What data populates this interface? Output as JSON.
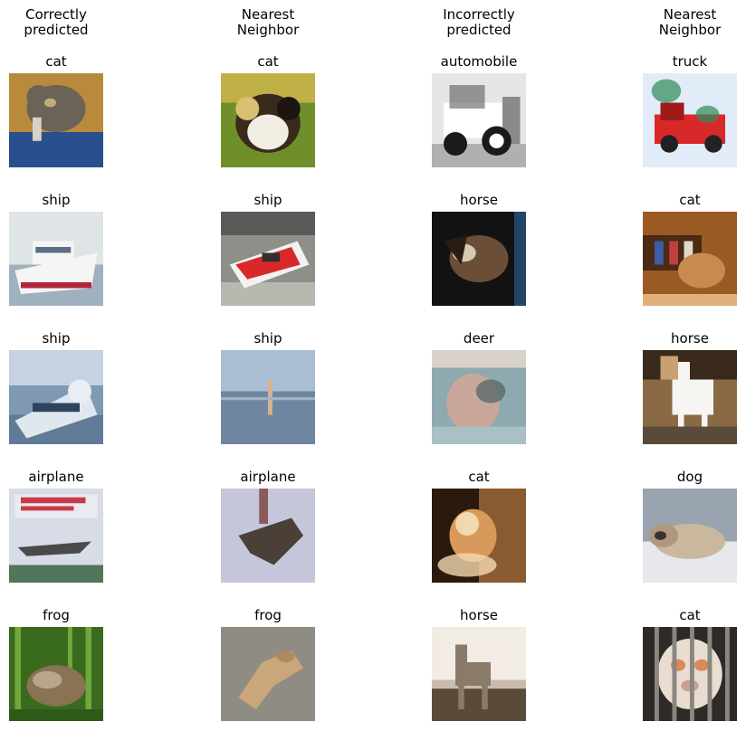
{
  "headers": [
    "Correctly\npredicted",
    "Nearest\nNeighbor",
    "Incorrectly\npredicted",
    "Nearest\nNeighbor"
  ],
  "rows": [
    [
      {
        "label": "cat",
        "scene": "cat-orange",
        "bg": "#b98a3c",
        "mid": "#6b6258",
        "accent": "#2a4f8e",
        "light": "#d9d2c6"
      },
      {
        "label": "cat",
        "scene": "cat-green",
        "bg": "#6f8f2a",
        "mid": "#3a2a1c",
        "accent": "#d8c070",
        "light": "#f2ede2"
      },
      {
        "label": "automobile",
        "scene": "car-bw",
        "bg": "#e6e6e6",
        "mid": "#5c5c5c",
        "accent": "#1a1a1a",
        "light": "#ffffff"
      },
      {
        "label": "truck",
        "scene": "truck-red",
        "bg": "#cfe0f5",
        "mid": "#d9282a",
        "accent": "#2e8a5a",
        "light": "#f5f8fc"
      }
    ],
    [
      {
        "label": "ship",
        "scene": "ship-white",
        "bg": "#dfe5e6",
        "mid": "#f5f5f5",
        "accent": "#b3263a",
        "light": "#5a6f86"
      },
      {
        "label": "ship",
        "scene": "boat-red",
        "bg": "#8f8f8a",
        "mid": "#d9282a",
        "accent": "#f2f2f2",
        "light": "#b8b8b0"
      },
      {
        "label": "horse",
        "scene": "horse-dark",
        "bg": "#121212",
        "mid": "#6b4e38",
        "accent": "#d9c9b2",
        "light": "#2a5d8e"
      },
      {
        "label": "cat",
        "scene": "cat-wood",
        "bg": "#9a5a24",
        "mid": "#c98a50",
        "accent": "#3b5ea8",
        "light": "#e2b07a"
      }
    ],
    [
      {
        "label": "ship",
        "scene": "ship-blue",
        "bg": "#7f99b3",
        "mid": "#e1e7ee",
        "accent": "#2e435c",
        "light": "#c5d3e0"
      },
      {
        "label": "ship",
        "scene": "sea-calm",
        "bg": "#8fa7c2",
        "mid": "#6f86a1",
        "accent": "#d9b48a",
        "light": "#a9bdd3"
      },
      {
        "label": "deer",
        "scene": "deer-blur",
        "bg": "#8ea9b0",
        "mid": "#c9a79a",
        "accent": "#5a6b6b",
        "light": "#d9d2c9"
      },
      {
        "label": "horse",
        "scene": "horse-white",
        "bg": "#8a6a45",
        "mid": "#f5f5f2",
        "accent": "#3a2a1c",
        "light": "#c9a070"
      }
    ],
    [
      {
        "label": "airplane",
        "scene": "plane-poster",
        "bg": "#d8dce6",
        "mid": "#4a4a4a",
        "accent": "#c83a46",
        "light": "#2e5d3a"
      },
      {
        "label": "airplane",
        "scene": "plane-lavender",
        "bg": "#bdbcd4",
        "mid": "#4a4038",
        "accent": "#8c5a5a",
        "light": "#d5d4e4"
      },
      {
        "label": "cat",
        "scene": "cat-shadow",
        "bg": "#2a1a0e",
        "mid": "#d89a5a",
        "accent": "#f2d8b0",
        "light": "#8a5a30"
      },
      {
        "label": "dog",
        "scene": "dog-sleep",
        "bg": "#9aa3b0",
        "mid": "#c9b89e",
        "accent": "#3a3430",
        "light": "#e6e8ec"
      }
    ],
    [
      {
        "label": "frog",
        "scene": "frog-grass",
        "bg": "#3a6a1e",
        "mid": "#8a7254",
        "accent": "#6fa83a",
        "light": "#b8a58a"
      },
      {
        "label": "frog",
        "scene": "frog-gravel",
        "bg": "#7d7a72",
        "mid": "#c9a77a",
        "accent": "#5e5a52",
        "light": "#a19d94"
      },
      {
        "label": "horse",
        "scene": "horse-beach",
        "bg": "#f2ece4",
        "mid": "#8a7a6a",
        "accent": "#5a4a3a",
        "light": "#c9bcae"
      },
      {
        "label": "cat",
        "scene": "cat-cage",
        "bg": "#2e2a28",
        "mid": "#e9dcd0",
        "accent": "#d88a5a",
        "light": "#8a8680"
      }
    ]
  ]
}
